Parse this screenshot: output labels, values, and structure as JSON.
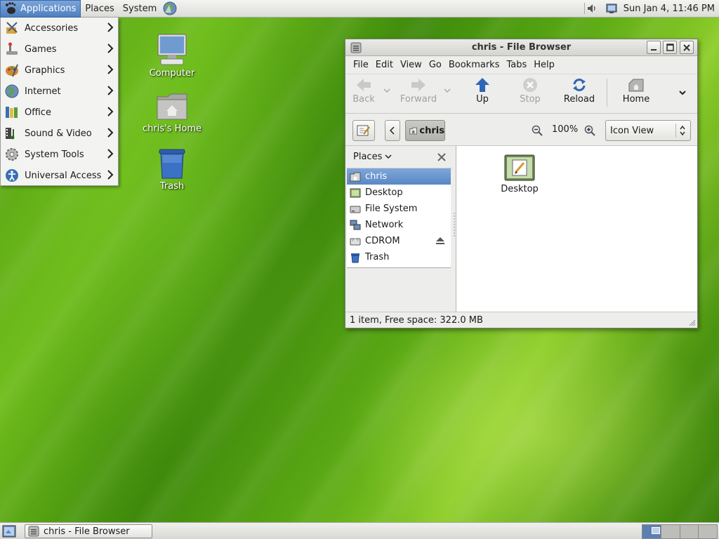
{
  "top_panel": {
    "menus": [
      "Applications",
      "Places",
      "System"
    ],
    "clock": "Sun Jan  4, 11:46 PM"
  },
  "app_menu": {
    "items": [
      {
        "label": "Accessories",
        "icon": "accessories-icon"
      },
      {
        "label": "Games",
        "icon": "games-icon"
      },
      {
        "label": "Graphics",
        "icon": "graphics-icon"
      },
      {
        "label": "Internet",
        "icon": "internet-icon"
      },
      {
        "label": "Office",
        "icon": "office-icon"
      },
      {
        "label": "Sound & Video",
        "icon": "sound-video-icon"
      },
      {
        "label": "System Tools",
        "icon": "system-tools-icon"
      },
      {
        "label": "Universal Access",
        "icon": "universal-access-icon"
      }
    ]
  },
  "desktop": {
    "icons": [
      {
        "label": "Computer",
        "icon": "computer-icon"
      },
      {
        "label": "chris's Home",
        "icon": "home-folder-icon"
      },
      {
        "label": "Trash",
        "icon": "trash-icon"
      }
    ]
  },
  "window": {
    "title": "chris - File Browser",
    "menubar": [
      "File",
      "Edit",
      "View",
      "Go",
      "Bookmarks",
      "Tabs",
      "Help"
    ],
    "toolbar": {
      "back": "Back",
      "forward": "Forward",
      "up": "Up",
      "stop": "Stop",
      "reload": "Reload",
      "home": "Home"
    },
    "location": {
      "crumb": "chris",
      "zoom": "100%",
      "view_mode": "Icon View"
    },
    "sidepane": {
      "header": "Places",
      "places": [
        {
          "label": "chris",
          "selected": true
        },
        {
          "label": "Desktop"
        },
        {
          "label": "File System"
        },
        {
          "label": "Network"
        },
        {
          "label": "CDROM"
        },
        {
          "label": "Trash"
        }
      ]
    },
    "files": [
      {
        "label": "Desktop",
        "icon": "desktop-folder-icon"
      }
    ],
    "status": "1 item, Free space: 322.0 MB"
  },
  "bottom_panel": {
    "task": "chris - File Browser",
    "workspaces": 4,
    "active_workspace": 1
  },
  "colors": {
    "selection": "#5a88c6",
    "wallpaper": "#5aa814"
  }
}
